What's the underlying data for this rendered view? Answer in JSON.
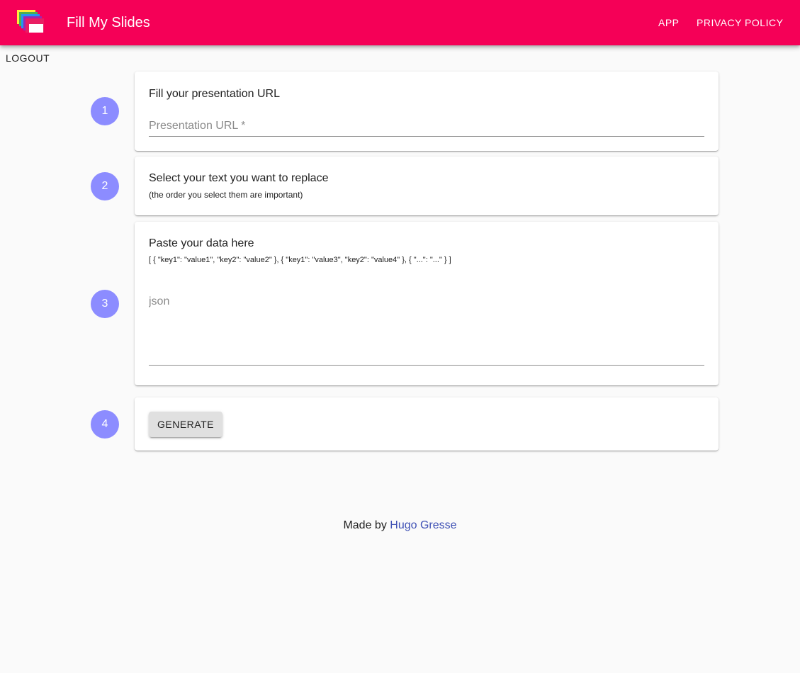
{
  "header": {
    "title": "Fill My Slides",
    "logo_icon": "stacked-slides-icon",
    "nav": [
      {
        "label": "APP"
      },
      {
        "label": "PRIVACY POLICY"
      }
    ]
  },
  "logout_label": "LOGOUT",
  "steps": [
    {
      "number": "1",
      "title": "Fill your presentation URL",
      "input_placeholder": "Presentation URL *",
      "input_value": ""
    },
    {
      "number": "2",
      "title": "Select your text you want to replace",
      "subtitle": "(the order you select them are important)"
    },
    {
      "number": "3",
      "title": "Paste your data here",
      "subtitle": "[ { \"key1\": \"value1\", \"key2\": \"value2\" }, { \"key1\": \"value3\", \"key2\": \"value4\" }, { \"...\": \"...\" } ]",
      "input_placeholder": "json",
      "input_value": ""
    },
    {
      "number": "4",
      "button_label": "GENERATE"
    }
  ],
  "footer": {
    "prefix": "Made by",
    "author_link": "Hugo Gresse"
  },
  "colors": {
    "appbar": "#f50057",
    "step_circle": "#8c8cff",
    "link": "#3f51b5"
  }
}
